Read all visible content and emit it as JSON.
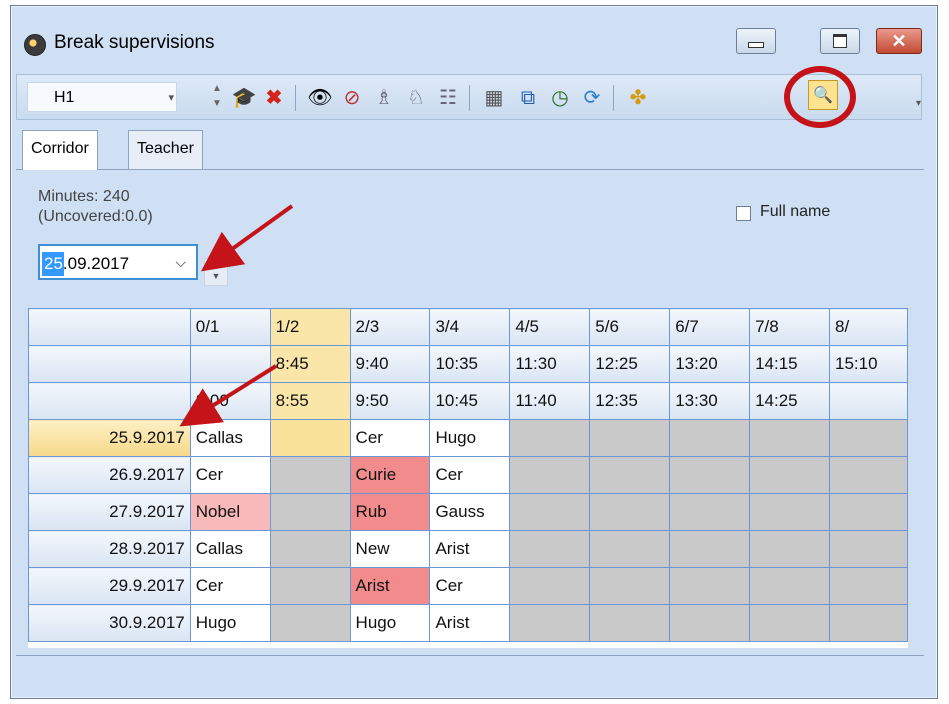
{
  "window": {
    "title": "Break supervisions",
    "icon": "clock-icon"
  },
  "toolbar": {
    "class_value": "H1",
    "icons": [
      "teacher-hat-icon",
      "delete-icon",
      "eye-icon",
      "eye-off-icon",
      "assign-icon",
      "swap-icon",
      "list-icon",
      "calculator-icon",
      "copy-icon",
      "clock-icon",
      "refresh-icon",
      "puzzle-icon",
      "search-window-icon"
    ]
  },
  "tabs": [
    {
      "label": "Corridor"
    },
    {
      "label": "Teacher"
    }
  ],
  "info": {
    "minutes": "Minutes: 240",
    "uncovered": "(Uncovered:0.0)"
  },
  "date": {
    "highlight": "25",
    "rest": ".09.2017"
  },
  "fullname": {
    "label": "Full name"
  },
  "grid": {
    "periods": [
      "0/1",
      "1/2",
      "2/3",
      "3/4",
      "4/5",
      "5/6",
      "6/7",
      "7/8",
      "8/"
    ],
    "start_times": [
      "",
      "8:45",
      "9:40",
      "10:35",
      "11:30",
      "12:25",
      "13:20",
      "14:15",
      "15:10"
    ],
    "end_times": [
      "8:00",
      "8:55",
      "9:50",
      "10:45",
      "11:40",
      "12:35",
      "13:30",
      "14:25",
      ""
    ],
    "rows": [
      {
        "date": "25.9.2017",
        "cells": [
          "Callas",
          "",
          "Cer",
          "Hugo",
          "",
          "",
          "",
          "",
          ""
        ]
      },
      {
        "date": "26.9.2017",
        "cells": [
          "Cer",
          "",
          "Curie",
          "Cer",
          "",
          "",
          "",
          "",
          ""
        ]
      },
      {
        "date": "27.9.2017",
        "cells": [
          "Nobel",
          "",
          "Rub",
          "Gauss",
          "",
          "",
          "",
          "",
          ""
        ]
      },
      {
        "date": "28.9.2017",
        "cells": [
          "Callas",
          "",
          "New",
          "Arist",
          "",
          "",
          "",
          "",
          ""
        ]
      },
      {
        "date": "29.9.2017",
        "cells": [
          "Cer",
          "",
          "Arist",
          "Cer",
          "",
          "",
          "",
          "",
          ""
        ]
      },
      {
        "date": "30.9.2017",
        "cells": [
          "Hugo",
          "",
          "Hugo",
          "Arist",
          "",
          "",
          "",
          "",
          ""
        ]
      }
    ]
  },
  "colors": {
    "highlight_red": "#c4141a",
    "selected_yellow": "#fbe29a",
    "conflict_red": "#f28b8b"
  }
}
